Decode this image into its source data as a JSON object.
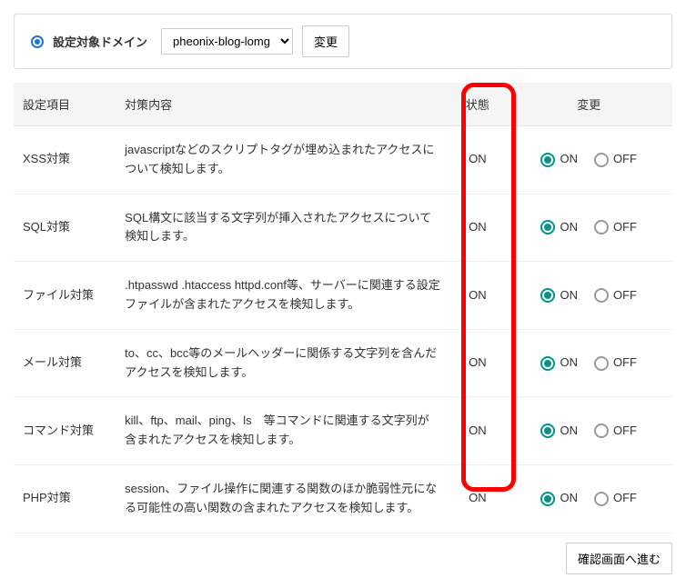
{
  "domainSelector": {
    "label": "設定対象ドメイン",
    "selected": "pheonix-blog-lomg",
    "changeButton": "変更"
  },
  "table": {
    "headers": {
      "item": "設定項目",
      "desc": "対策内容",
      "state": "状態",
      "change": "変更"
    },
    "radioLabels": {
      "on": "ON",
      "off": "OFF"
    },
    "rows": [
      {
        "item": "XSS対策",
        "desc": "javascriptなどのスクリプトタグが埋め込まれたアクセスについて検知します。",
        "state": "ON",
        "selected": "on"
      },
      {
        "item": "SQL対策",
        "desc": "SQL構文に該当する文字列が挿入されたアクセスについて検知します。",
        "state": "ON",
        "selected": "on"
      },
      {
        "item": "ファイル対策",
        "desc": ".htpasswd .htaccess httpd.conf等、サーバーに関連する設定ファイルが含まれたアクセスを検知します。",
        "state": "ON",
        "selected": "on"
      },
      {
        "item": "メール対策",
        "desc": "to、cc、bcc等のメールヘッダーに関係する文字列を含んだアクセスを検知します。",
        "state": "ON",
        "selected": "on"
      },
      {
        "item": "コマンド対策",
        "desc": "kill、ftp、mail、ping、ls　等コマンドに関連する文字列が含まれたアクセスを検知します。",
        "state": "ON",
        "selected": "on"
      },
      {
        "item": "PHP対策",
        "desc": "session、ファイル操作に関連する関数のほか脆弱性元になる可能性の高い関数の含まれたアクセスを検知します。",
        "state": "ON",
        "selected": "on"
      }
    ]
  },
  "footer": {
    "confirmButton": "確認画面へ進む"
  }
}
